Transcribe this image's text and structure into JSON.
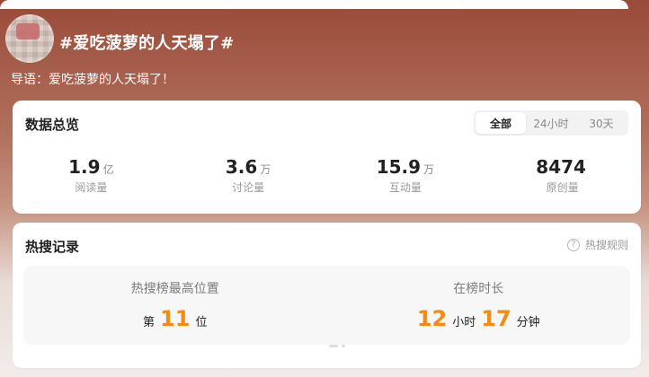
{
  "header": {
    "topic_title": "#爱吃菠萝的人天塌了#",
    "guide_text": "导语：爱吃菠萝的人天塌了！"
  },
  "overview": {
    "title": "数据总览",
    "tabs": [
      {
        "label": "全部",
        "active": true
      },
      {
        "label": "24小时",
        "active": false
      },
      {
        "label": "30天",
        "active": false
      }
    ],
    "stats": [
      {
        "value": "1.9",
        "unit": "亿",
        "label": "阅读量"
      },
      {
        "value": "3.6",
        "unit": "万",
        "label": "讨论量"
      },
      {
        "value": "15.9",
        "unit": "万",
        "label": "互动量"
      },
      {
        "value": "8474",
        "unit": "",
        "label": "原创量"
      }
    ]
  },
  "hot_search": {
    "title": "热搜记录",
    "rules_label": "热搜规则",
    "rules_icon": "question-icon",
    "highest": {
      "title": "热搜榜最高位置",
      "prefix": "第",
      "value": "11",
      "suffix": "位"
    },
    "duration": {
      "title": "在榜时长",
      "hours": "12",
      "hours_unit": "小时",
      "minutes": "17",
      "minutes_unit": "分钟"
    }
  },
  "colors": {
    "accent": "#f08b15",
    "header_top": "#9a4a39",
    "header_mid": "#b0705c"
  }
}
